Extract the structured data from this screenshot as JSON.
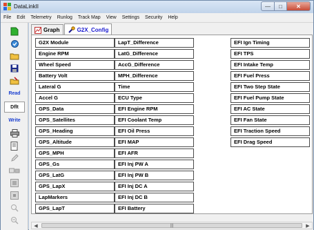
{
  "window": {
    "title": "DataLinkII"
  },
  "menu": [
    "File",
    "Edit",
    "Telemetry",
    "Runlog",
    "Track Map",
    "View",
    "Settings",
    "Security",
    "Help"
  ],
  "toolbar": {
    "read_label": "Read",
    "dflt_label": "Dflt",
    "write_label": "Write"
  },
  "tabs": [
    {
      "label": "Graph"
    },
    {
      "label": "G2X_Config"
    }
  ],
  "columns": [
    [
      "G2X Module",
      "Engine RPM",
      "Wheel Speed",
      "Battery Volt",
      "Lateral G",
      "Accel G",
      "GPS_Data",
      "GPS_Satellites",
      "GPS_Heading",
      "GPS_Altitude",
      "GPS_MPH",
      "GPS_Gs",
      "GPS_LatG",
      "GPS_LapX",
      "LapMarkers",
      "GPS_LapT"
    ],
    [
      "LapT_Difference",
      "LatG_Difference",
      "AccG_Difference",
      "MPH_Difference",
      "Time",
      "ECU Type",
      "EFI Engine RPM",
      "EFI Coolant Temp",
      "EFI Oil Press",
      "EFI MAP",
      "EFI AFR",
      "EFI Inj PW A",
      "EFI Inj PW B",
      "EFI Inj DC A",
      "EFI Inj DC B",
      "EFI Battery"
    ],
    [
      "EFI Ign Timing",
      "EFI TPS",
      "EFI Intake Temp",
      "EFI Fuel Press",
      "EFI Two Step State",
      "EFI Fuel Pump State",
      "EFI AC State",
      "EFI Fan State",
      "EFI Traction Speed",
      "EFI Drag Speed"
    ]
  ],
  "colors": {
    "active_tab_text": "#1a1ad0",
    "tool_text_blue": "#1a3fd0",
    "close_button": "#c74a36"
  }
}
